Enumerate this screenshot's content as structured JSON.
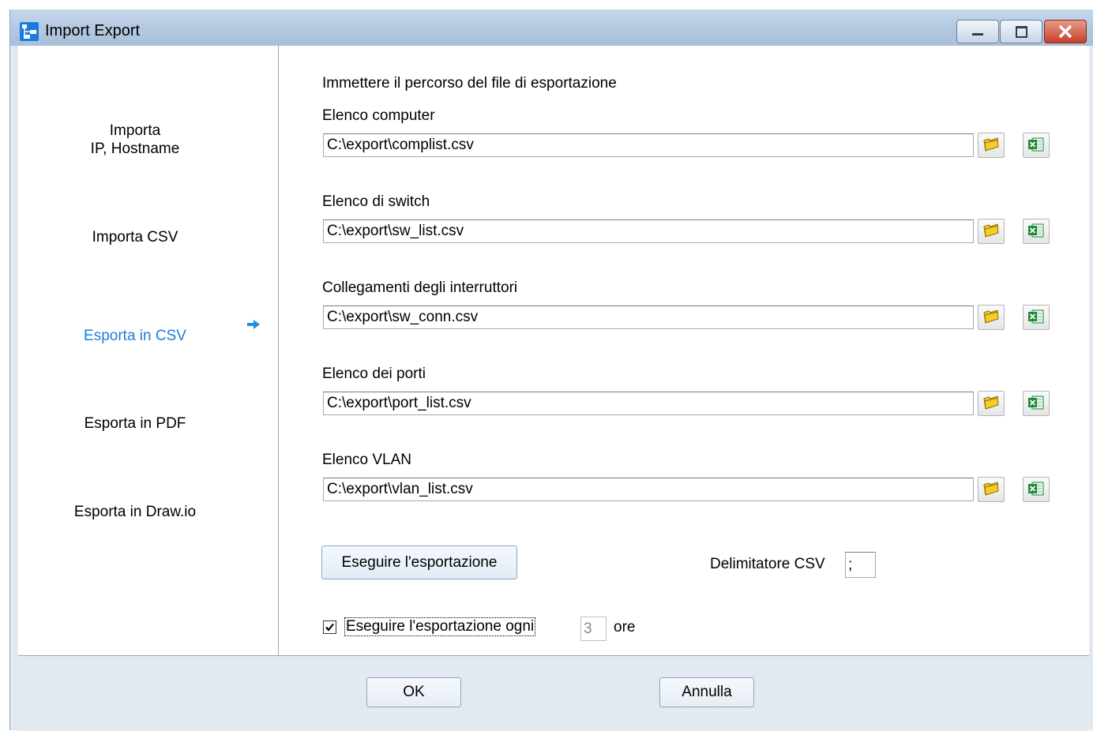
{
  "window": {
    "title": "Import Export"
  },
  "sidebar": {
    "items": [
      {
        "line1": "Importa",
        "line2": "IP, Hostname"
      },
      {
        "label": "Importa CSV"
      },
      {
        "label": "Esporta in CSV",
        "active": true
      },
      {
        "label": "Esporta in PDF"
      },
      {
        "label": "Esporta in Draw.io"
      }
    ]
  },
  "main": {
    "instruction": "Immettere il percorso del file di esportazione",
    "fields": [
      {
        "label": "Elenco computer",
        "value": "C:\\export\\complist.csv"
      },
      {
        "label": "Elenco di switch",
        "value": "C:\\export\\sw_list.csv"
      },
      {
        "label": "Collegamenti degli interruttori",
        "value": "C:\\export\\sw_conn.csv"
      },
      {
        "label": "Elenco dei porti",
        "value": "C:\\export\\port_list.csv"
      },
      {
        "label": "Elenco VLAN",
        "value": "C:\\export\\vlan_list.csv"
      }
    ],
    "run_button": "Eseguire l'esportazione",
    "delimiter_label": "Delimitatore CSV",
    "delimiter_value": ";",
    "schedule": {
      "checked": true,
      "label": "Eseguire l'esportazione ogni",
      "value": "3",
      "unit": "ore"
    }
  },
  "footer": {
    "ok": "OK",
    "cancel": "Annulla"
  },
  "colors": {
    "accent": "#1e7ed8",
    "folder": "#f2c318",
    "excel": "#1f8a3b"
  }
}
